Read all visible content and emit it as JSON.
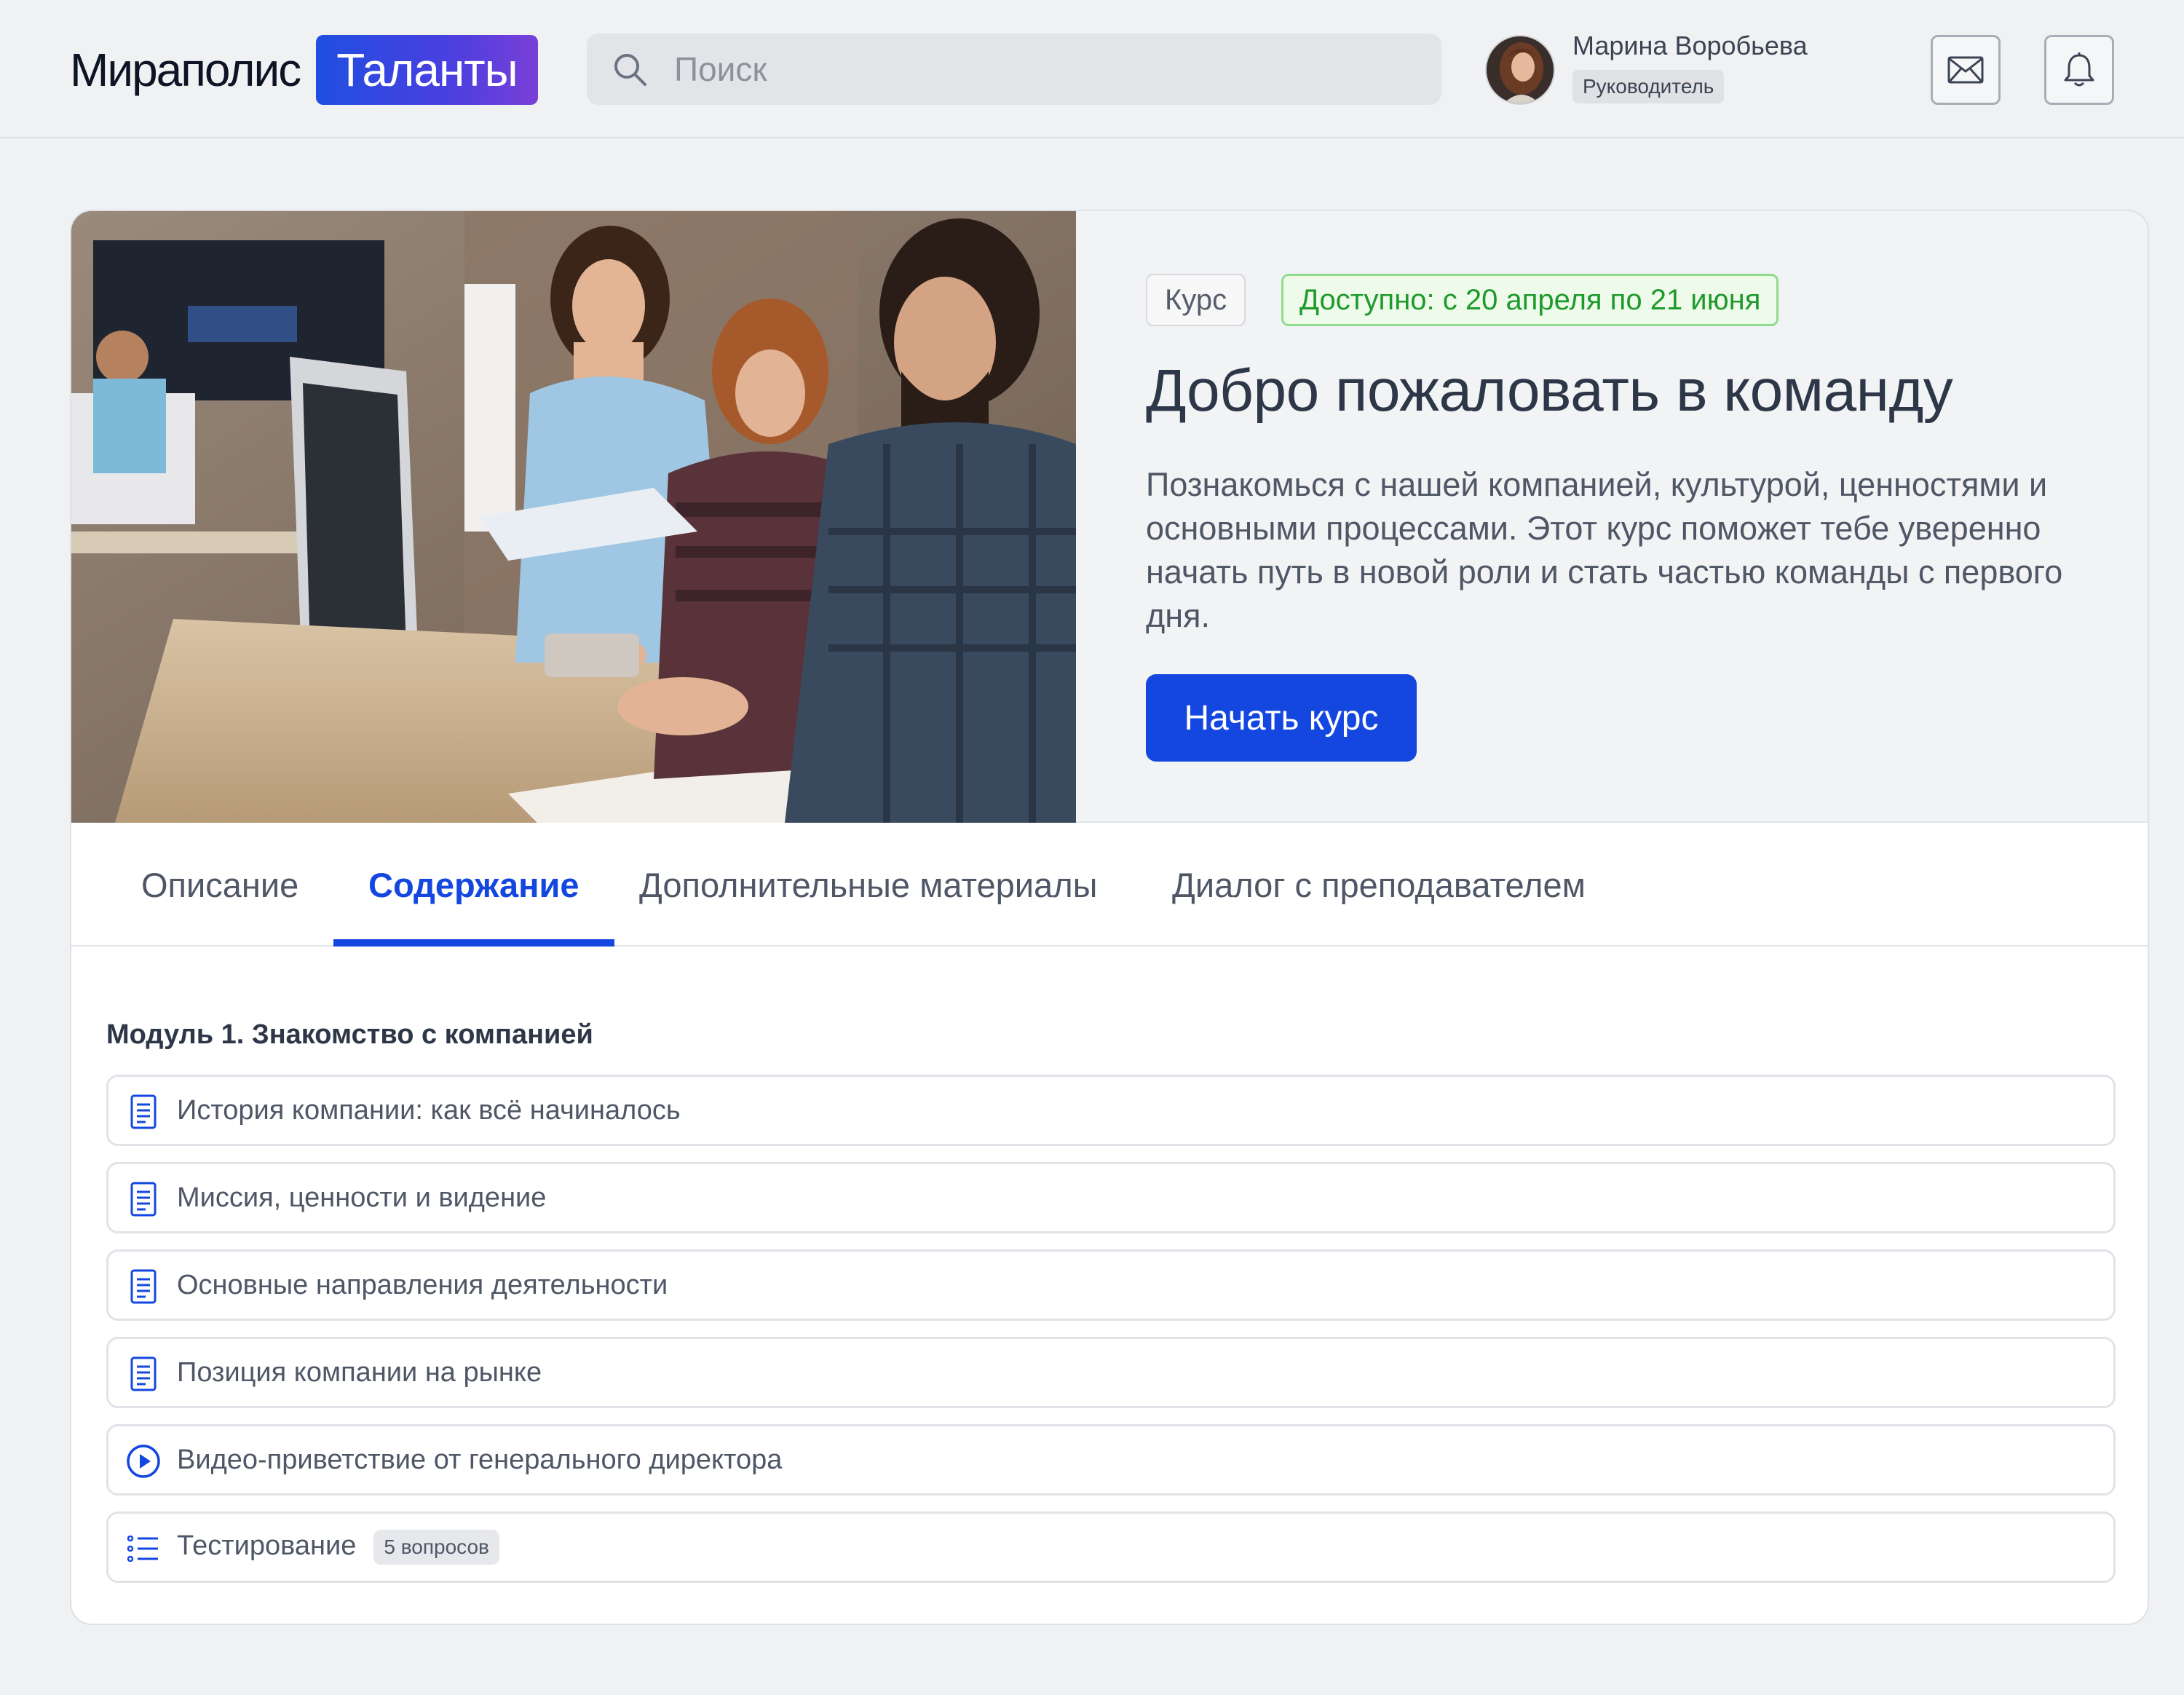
{
  "header": {
    "logo_main": "Мираполис",
    "logo_badge": "Таланты",
    "search_placeholder": "Поиск",
    "user_name": "Марина Воробьева",
    "user_role": "Руководитель",
    "icons": [
      "search-icon",
      "mail-icon",
      "bell-icon"
    ]
  },
  "hero": {
    "tag_type": "Курс",
    "tag_availability": "Доступно: с 20 апреля по 21 июня",
    "title": "Добро пожаловать в команду",
    "description": "Познакомься с нашей компанией, культурой, ценностями и основными процессами. Этот курс поможет тебе уверенно начать путь в новой роли и стать частью команды с первого дня.",
    "start_button": "Начать курс"
  },
  "tabs": [
    {
      "label": "Описание",
      "active": false
    },
    {
      "label": "Содержание",
      "active": true
    },
    {
      "label": "Дополнительные материалы",
      "active": false
    },
    {
      "label": "Диалог с преподавателем",
      "active": false
    }
  ],
  "module": {
    "title": "Модуль 1. Знакомство с компанией",
    "lessons": [
      {
        "label": "История компании: как всё начиналось",
        "icon": "document-icon"
      },
      {
        "label": "Миссия, ценности и видение",
        "icon": "document-icon"
      },
      {
        "label": "Основные направления деятельности",
        "icon": "document-icon"
      },
      {
        "label": "Позиция компании на рынке",
        "icon": "document-icon"
      },
      {
        "label": "Видео-приветствие от генерального директора",
        "icon": "play-icon"
      },
      {
        "label": "Тестирование",
        "icon": "list-icon",
        "badge": "5 вопросов"
      }
    ]
  },
  "colors": {
    "accent": "#1447e0",
    "available_text": "#1e9a2c",
    "available_bg": "#eefbea"
  }
}
